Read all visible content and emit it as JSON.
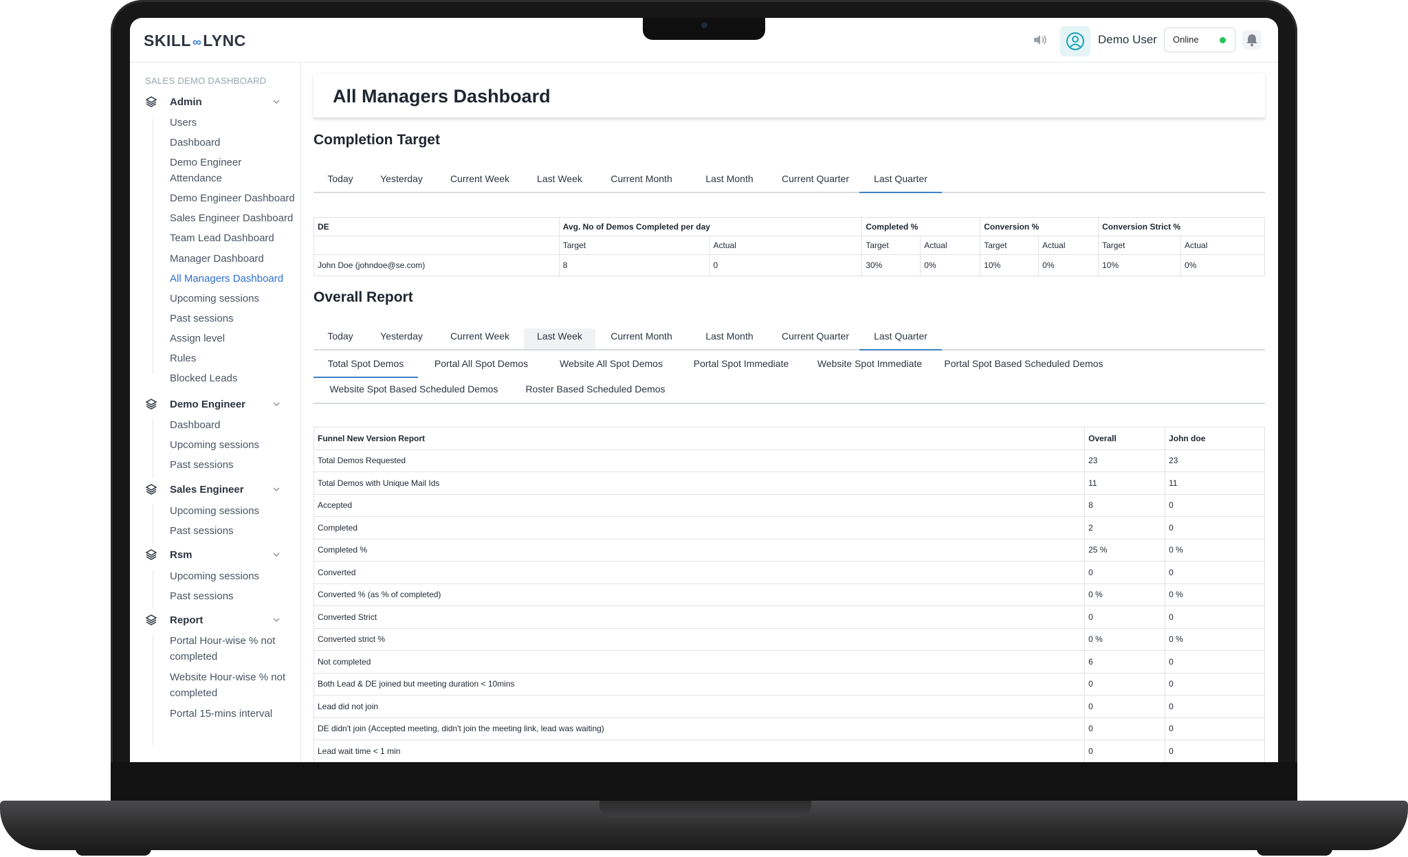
{
  "brand": {
    "logo_left": "SKILL",
    "logo_mid": "∞",
    "logo_right": "LYNC"
  },
  "header": {
    "user_name": "Demo User",
    "status": "Online"
  },
  "sidebar": {
    "title": "SALES DEMO DASHBOARD",
    "sections": [
      {
        "label": "Admin",
        "items": [
          "Users",
          "Dashboard",
          "Demo Engineer Attendance",
          "Demo Engineer Dashboard",
          "Sales Engineer Dashboard",
          "Team Lead Dashboard",
          "Manager Dashboard",
          "All Managers Dashboard",
          "Upcoming sessions",
          "Past sessions",
          "Assign level",
          "Rules",
          "Blocked Leads"
        ]
      },
      {
        "label": "Demo Engineer",
        "items": [
          "Dashboard",
          "Upcoming sessions",
          "Past sessions"
        ]
      },
      {
        "label": "Sales Engineer",
        "items": [
          "Upcoming sessions",
          "Past sessions"
        ]
      },
      {
        "label": "Rsm",
        "items": [
          "Upcoming sessions",
          "Past sessions"
        ]
      },
      {
        "label": "Report",
        "items": [
          "Portal Hour-wise % not completed",
          "Website Hour-wise % not completed",
          "Portal 15-mins interval"
        ]
      }
    ],
    "active_item": "All Managers Dashboard"
  },
  "page": {
    "title": "All Managers Dashboard"
  },
  "completion_target": {
    "heading": "Completion Target",
    "tabs": [
      "Today",
      "Yesterday",
      "Current Week",
      "Last Week",
      "Current Month",
      "Last Month",
      "Current Quarter",
      "Last Quarter"
    ],
    "active_tab": "Last Quarter",
    "headers": {
      "de": "DE",
      "avg": "Avg. No of Demos Completed per day",
      "completed": "Completed %",
      "conversion": "Conversion %",
      "conversion_strict": "Conversion Strict %",
      "target": "Target",
      "actual": "Actual"
    },
    "rows": [
      {
        "de": "John Doe (johndoe@se.com)",
        "avg_target": "8",
        "avg_actual": "0",
        "completed_target": "30%",
        "completed_actual": "0%",
        "conversion_target": "10%",
        "conversion_actual": "0%",
        "strict_target": "10%",
        "strict_actual": "0%"
      }
    ]
  },
  "overall_report": {
    "heading": "Overall Report",
    "tabs": [
      "Today",
      "Yesterday",
      "Current Week",
      "Last Week",
      "Current Month",
      "Last Month",
      "Current Quarter",
      "Last Quarter"
    ],
    "active_tab": "Last Quarter",
    "hover_tab": "Last Week",
    "subtabs": [
      "Total Spot Demos",
      "Portal All Spot Demos",
      "Website All Spot Demos",
      "Portal Spot Immediate",
      "Website Spot Immediate",
      "Portal Spot Based Scheduled Demos",
      "Website Spot Based Scheduled Demos",
      "Roster Based Scheduled Demos"
    ],
    "active_subtab": "Total Spot Demos",
    "table": {
      "columns": [
        "Funnel New Version Report",
        "Overall",
        "John doe"
      ],
      "rows": [
        [
          "Total Demos Requested",
          "23",
          "23"
        ],
        [
          "Total Demos with Unique Mail Ids",
          "11",
          "11"
        ],
        [
          "Accepted",
          "8",
          "0"
        ],
        [
          "Completed",
          "2",
          "0"
        ],
        [
          "Completed %",
          "25 %",
          "0 %"
        ],
        [
          "Converted",
          "0",
          "0"
        ],
        [
          "Converted % (as % of completed)",
          "0 %",
          "0 %"
        ],
        [
          "Converted Strict",
          "0",
          "0"
        ],
        [
          "Converted strict %",
          "0 %",
          "0 %"
        ],
        [
          "Not completed",
          "6",
          "0"
        ],
        [
          "Both Lead & DE joined but meeting duration < 10mins",
          "0",
          "0"
        ],
        [
          "Lead did not join",
          "0",
          "0"
        ],
        [
          "DE didn't join (Accepted meeting, didn't join the meeting link, lead was waiting)",
          "0",
          "0"
        ],
        [
          "Lead wait time < 1 min",
          "0",
          "0"
        ]
      ]
    }
  },
  "icons": {
    "speaker": "speaker-icon",
    "avatar": "user-circle-icon",
    "bell": "bell-icon",
    "section": "layers-icon",
    "chevron": "chevron-down-icon"
  },
  "colors": {
    "accent": "#3b82c4",
    "active_link": "#2f6fd1",
    "online": "#22c55e"
  }
}
